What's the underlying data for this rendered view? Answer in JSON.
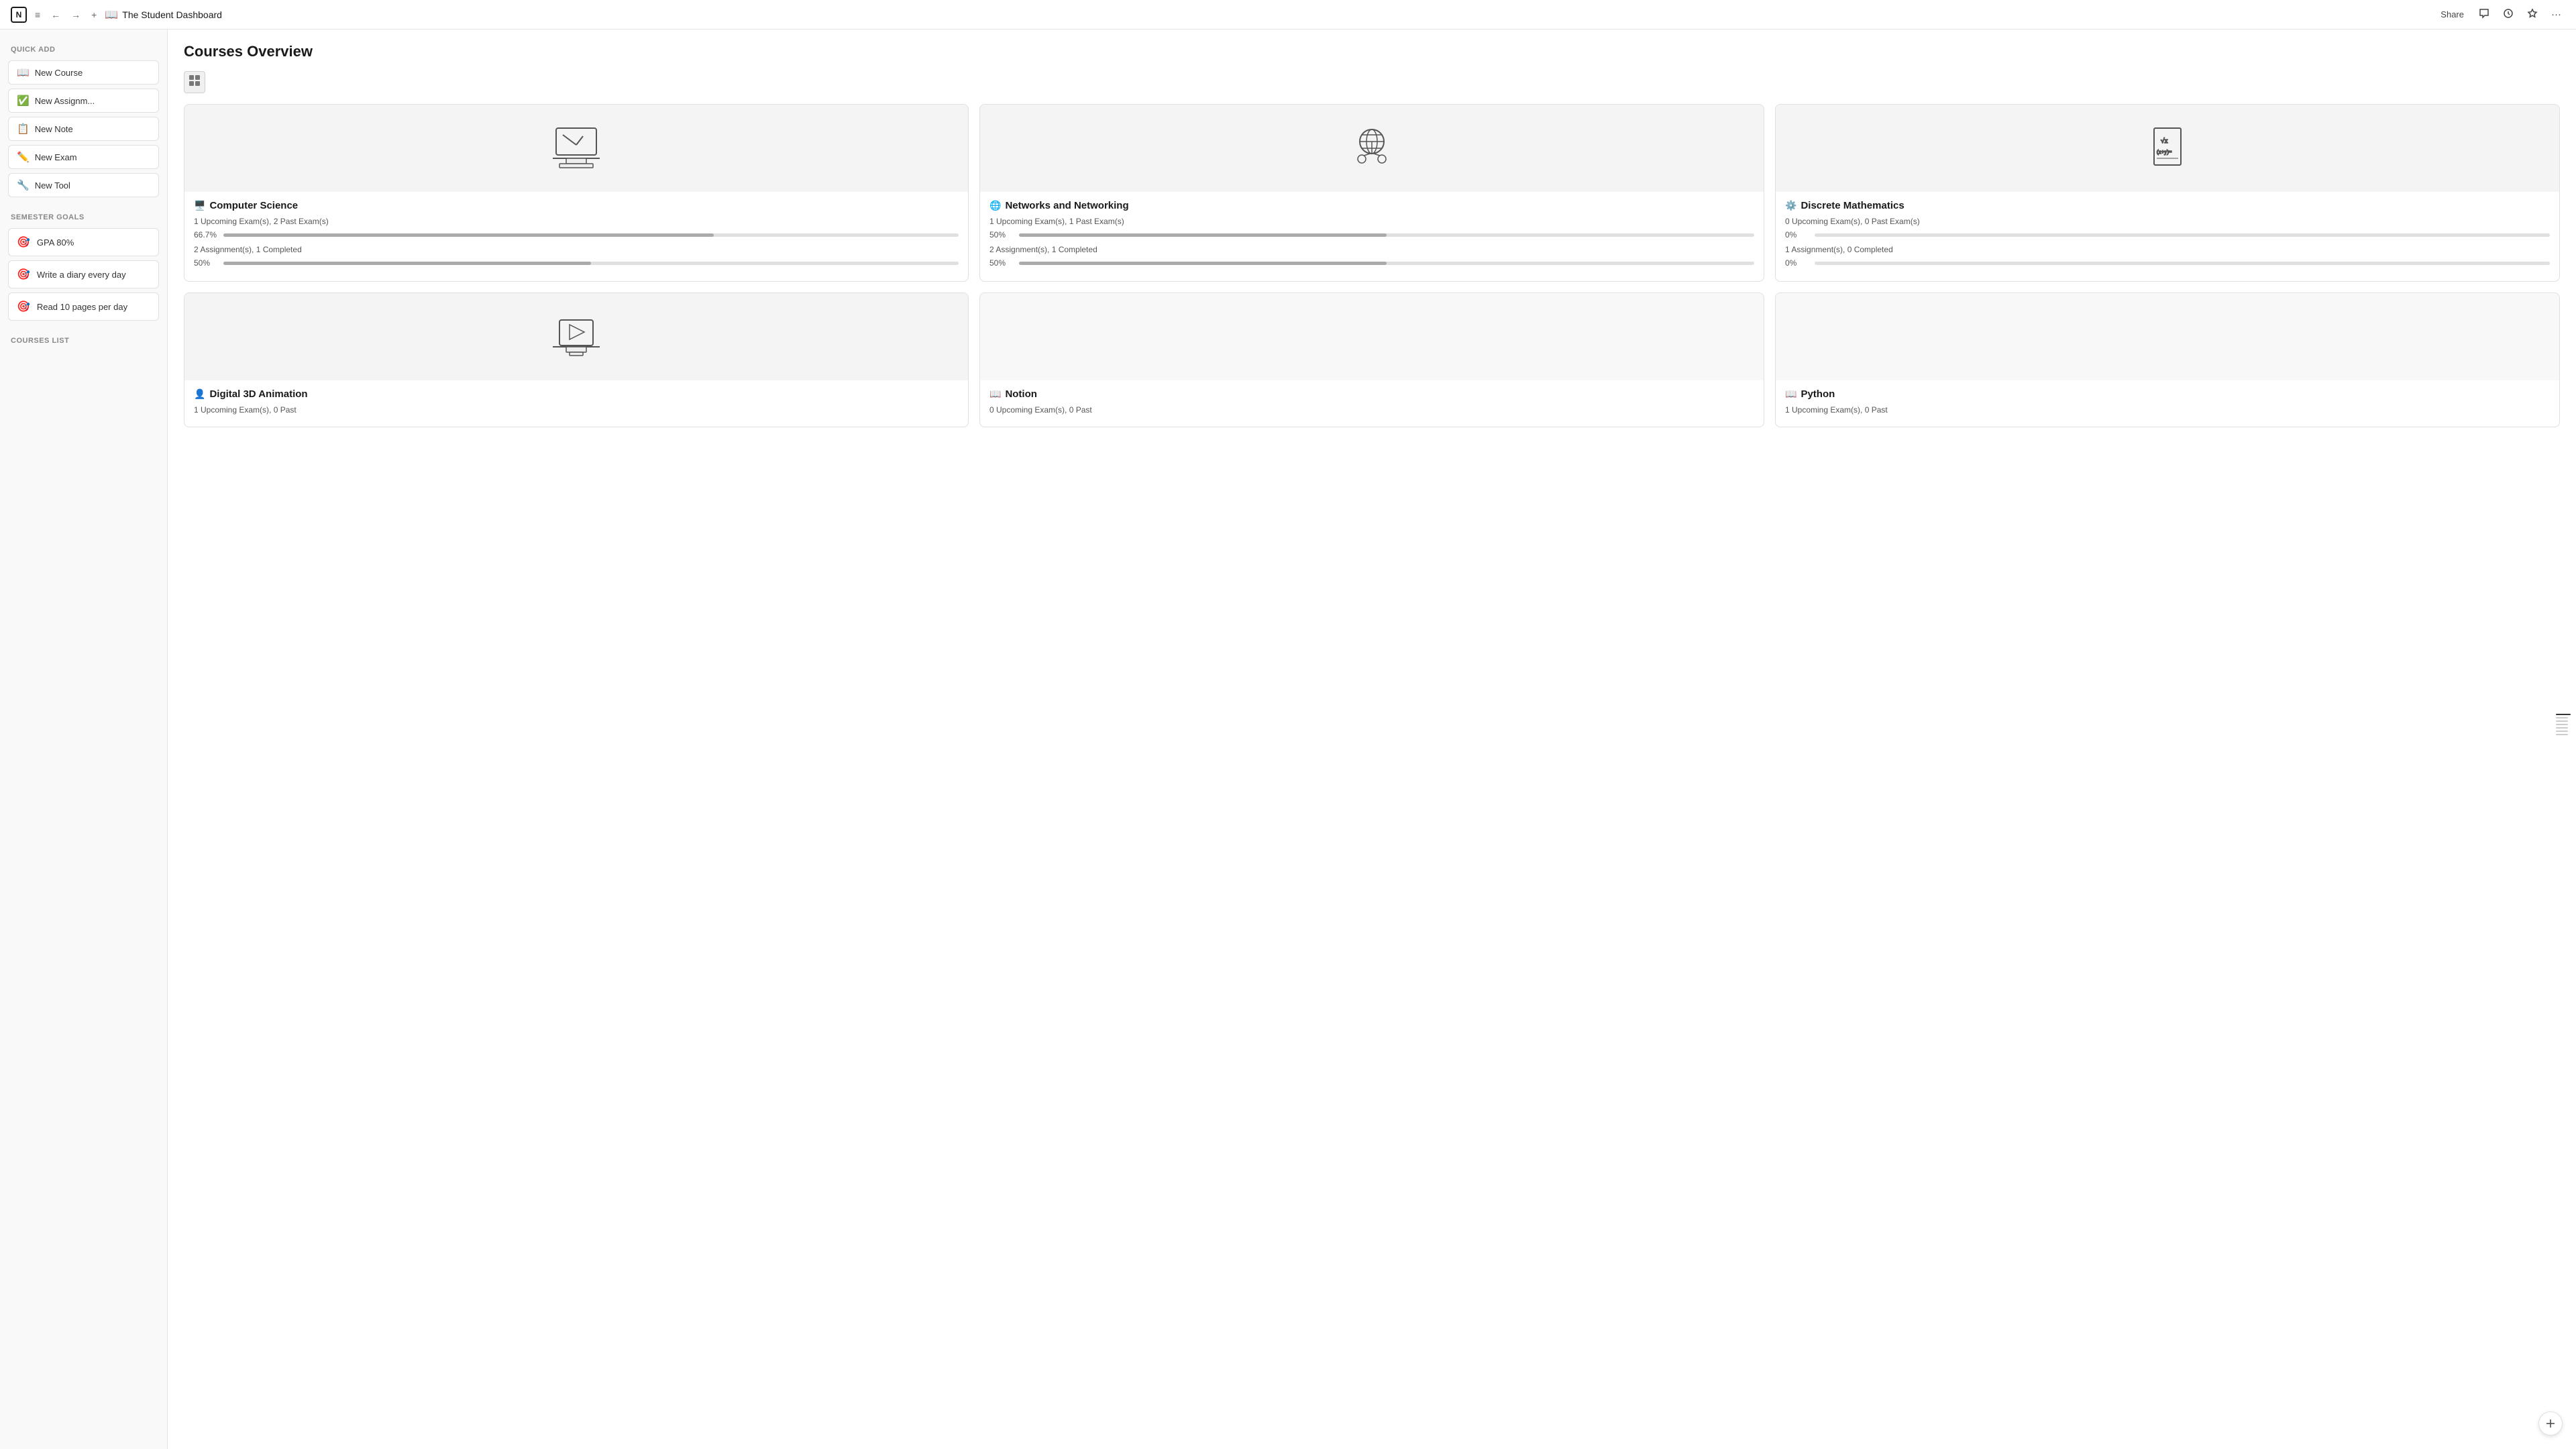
{
  "topbar": {
    "app_icon": "N",
    "title": "The Student Dashboard",
    "share_label": "Share",
    "hamburger": "≡",
    "back_arrow": "←",
    "forward_arrow": "→",
    "add_icon": "+",
    "book_icon": "📖",
    "comment_icon": "💬",
    "history_icon": "🕐",
    "star_icon": "☆",
    "more_icon": "···"
  },
  "sidebar": {
    "quick_add_title": "Quick Add",
    "quick_add_buttons": [
      {
        "id": "new-course",
        "icon": "📖",
        "label": "New Course"
      },
      {
        "id": "new-assignment",
        "icon": "✅",
        "label": "New Assignm..."
      },
      {
        "id": "new-note",
        "icon": "📋",
        "label": "New Note"
      },
      {
        "id": "new-exam",
        "icon": "✏️",
        "label": "New Exam"
      },
      {
        "id": "new-tool",
        "icon": "🔧",
        "label": "New Tool"
      }
    ],
    "semester_goals_title": "Semester Goals",
    "goals": [
      {
        "id": "gpa",
        "icon": "🎯",
        "label": "GPA 80%"
      },
      {
        "id": "diary",
        "icon": "🎯",
        "label": "Write a diary every day"
      },
      {
        "id": "reading",
        "icon": "🎯",
        "label": "Read 10 pages per day"
      }
    ],
    "courses_list_title": "Courses List"
  },
  "courses_overview": {
    "title": "Courses Overview",
    "grid_icon": "⊞",
    "courses": [
      {
        "id": "cs",
        "title": "Computer Science",
        "icon": "🖥️",
        "exam_info": "1 Upcoming Exam(s), 2 Past Exam(s)",
        "exam_progress": 66.7,
        "exam_progress_label": "66.7%",
        "assignment_info": "2 Assignment(s), 1 Completed",
        "assignment_progress": 50,
        "assignment_progress_label": "50%",
        "image_type": "computer"
      },
      {
        "id": "nn",
        "title": "Networks and Networking",
        "icon": "🌐",
        "exam_info": "1 Upcoming Exam(s), 1 Past Exam(s)",
        "exam_progress": 50,
        "exam_progress_label": "50%",
        "assignment_info": "2 Assignment(s), 1 Completed",
        "assignment_progress": 50,
        "assignment_progress_label": "50%",
        "image_type": "network"
      },
      {
        "id": "dm",
        "title": "Discrete Mathematics",
        "icon": "⚙️",
        "exam_info": "0 Upcoming Exam(s), 0 Past Exam(s)",
        "exam_progress": 0,
        "exam_progress_label": "0%",
        "assignment_info": "1 Assignment(s), 0 Completed",
        "assignment_progress": 0,
        "assignment_progress_label": "0%",
        "image_type": "math"
      },
      {
        "id": "d3d",
        "title": "Digital 3D Animation",
        "icon": "👤",
        "exam_info": "1 Upcoming Exam(s), 0 Past",
        "exam_progress": 0,
        "exam_progress_label": "",
        "assignment_info": "",
        "assignment_progress": 0,
        "assignment_progress_label": "",
        "image_type": "animation"
      },
      {
        "id": "notion",
        "title": "Notion",
        "icon": "📖",
        "exam_info": "0 Upcoming Exam(s), 0 Past",
        "exam_progress": 0,
        "exam_progress_label": "",
        "assignment_info": "",
        "assignment_progress": 0,
        "assignment_progress_label": "",
        "image_type": "empty"
      },
      {
        "id": "python",
        "title": "Python",
        "icon": "📖",
        "exam_info": "1 Upcoming Exam(s), 0 Past",
        "exam_progress": 0,
        "exam_progress_label": "",
        "assignment_info": "",
        "assignment_progress": 0,
        "assignment_progress_label": "",
        "image_type": "empty"
      }
    ]
  },
  "colors": {
    "progress_fill": "#aaa",
    "progress_bg": "#e0e0e0",
    "card_border": "#e0e0e0",
    "section_bg": "#f9f9f9"
  }
}
